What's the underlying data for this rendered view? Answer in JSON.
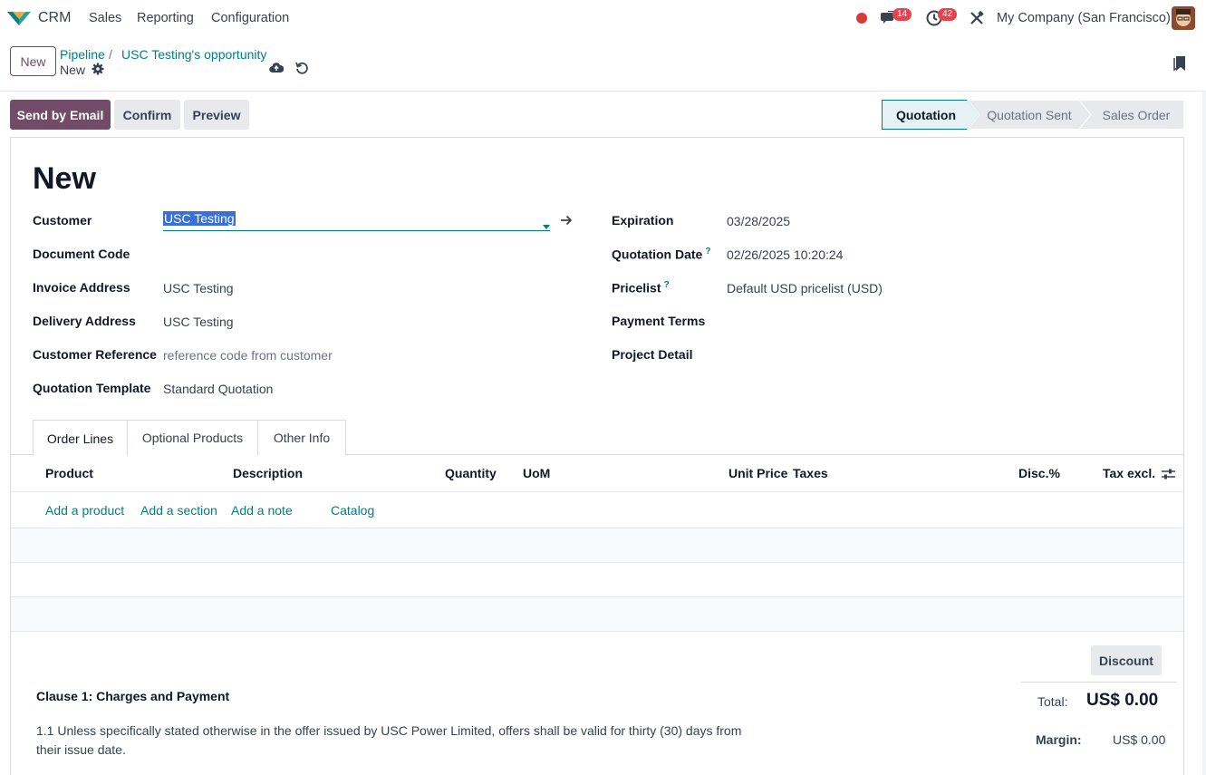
{
  "navbar": {
    "app_name": "CRM",
    "menu": [
      "Sales",
      "Reporting",
      "Configuration"
    ],
    "messages_count": "14",
    "activities_count": "42",
    "company": "My Company (San Francisco)"
  },
  "control_panel": {
    "new_label": "New",
    "breadcrumb": [
      "Pipeline",
      "USC Testing's opportunity"
    ],
    "current": "New"
  },
  "actions": {
    "send_email": "Send by Email",
    "confirm": "Confirm",
    "preview": "Preview"
  },
  "stages": [
    {
      "label": "Quotation",
      "active": true
    },
    {
      "label": "Quotation Sent",
      "active": false
    },
    {
      "label": "Sales Order",
      "active": false
    }
  ],
  "form": {
    "title": "New",
    "left": {
      "customer_label": "Customer",
      "customer_value": "USC Testing",
      "document_code_label": "Document Code",
      "invoice_address_label": "Invoice Address",
      "invoice_address_value": "USC Testing",
      "delivery_address_label": "Delivery Address",
      "delivery_address_value": "USC Testing",
      "customer_reference_label": "Customer Reference",
      "customer_reference_placeholder": "reference code from customer",
      "quotation_template_label": "Quotation Template",
      "quotation_template_value": "Standard Quotation"
    },
    "right": {
      "expiration_label": "Expiration",
      "expiration_value": "03/28/2025",
      "quotation_date_label": "Quotation Date",
      "quotation_date_value": "02/26/2025 10:20:24",
      "pricelist_label": "Pricelist",
      "pricelist_value": "Default USD pricelist (USD)",
      "payment_terms_label": "Payment Terms",
      "project_detail_label": "Project Detail",
      "help_mark": "?"
    }
  },
  "tabs": [
    "Order Lines",
    "Optional Products",
    "Other Info"
  ],
  "table": {
    "headers": [
      "Product",
      "Description",
      "Quantity",
      "UoM",
      "Unit Price",
      "Taxes",
      "Disc.%",
      "Tax excl."
    ],
    "add_links": [
      "Add a product",
      "Add a section",
      "Add a note",
      "Catalog"
    ]
  },
  "footer": {
    "discount_label": "Discount",
    "total_label": "Total:",
    "total_value": "US$ 0.00",
    "margin_label": "Margin:",
    "margin_value": "US$ 0.00",
    "clause_title": "Clause 1: Charges and Payment",
    "clause_line1": "1.1 Unless specifically stated otherwise in the offer issued by USC Power Limited, offers shall be valid for thirty (30) days from",
    "clause_line2": "their issue date."
  },
  "colors": {
    "brand": "#714b67",
    "link": "#017e84",
    "badge": "#e2454f"
  }
}
